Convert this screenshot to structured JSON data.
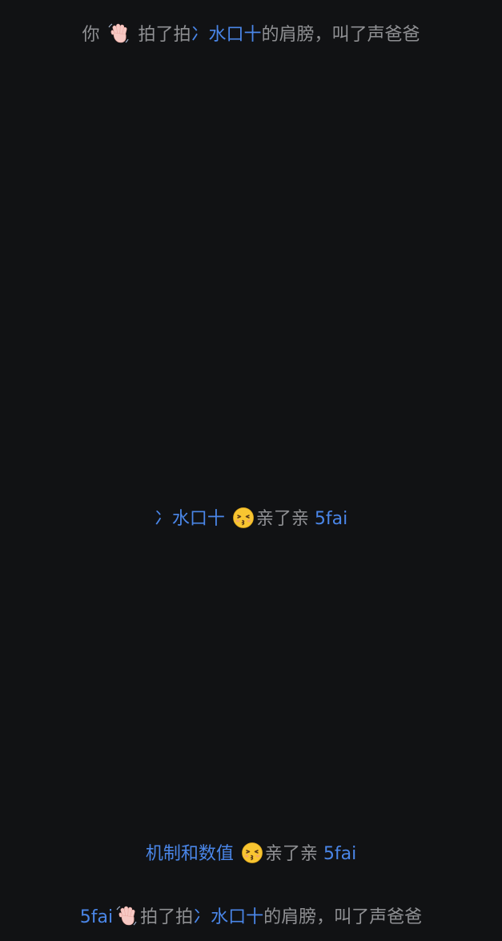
{
  "messages": [
    {
      "actor": "你",
      "actor_is_link": false,
      "action_icon": "waving-hand-icon",
      "verb": "拍了拍",
      "target": "冫水口十",
      "suffix": "的肩膀，叫了声爸爸"
    },
    {
      "actor": "冫水口十",
      "actor_is_link": true,
      "action_icon": "kissing-face-icon",
      "verb": "亲了亲",
      "target": "5fai",
      "suffix": ""
    },
    {
      "actor": "机制和数值",
      "actor_is_link": true,
      "action_icon": "kissing-face-icon",
      "verb": "亲了亲",
      "target": "5fai",
      "suffix": ""
    },
    {
      "actor": "5fai",
      "actor_is_link": true,
      "action_icon": "waving-hand-icon",
      "verb": "拍了拍",
      "target": "冫水口十",
      "suffix": "的肩膀，叫了声爸爸"
    }
  ],
  "colors": {
    "background": "#111214",
    "system_text": "#8f9093",
    "link": "#4a86e8"
  }
}
